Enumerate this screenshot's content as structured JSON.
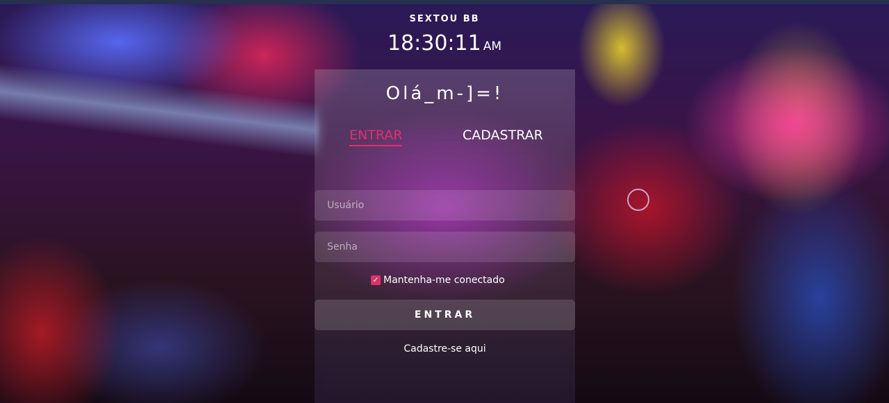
{
  "clock": {
    "label": "SEXTOU BB",
    "time": "18:30:11",
    "ampm": "AM"
  },
  "panel": {
    "greeting": "Olá_m-]=!"
  },
  "tabs": [
    {
      "label": "ENTRAR",
      "active": true
    },
    {
      "label": "CADASTRAR",
      "active": false
    }
  ],
  "form": {
    "username_placeholder": "Usuário",
    "username_value": "",
    "password_placeholder": "Senha",
    "password_value": "",
    "remember_label": "Mantenha-me conectado",
    "remember_checked": true,
    "submit_label": "ENTRAR",
    "register_link": "Cadastre-se aqui"
  },
  "colors": {
    "accent": "#e0306a",
    "text": "#ffffff"
  },
  "icons": {
    "checkbox": "check-icon"
  }
}
